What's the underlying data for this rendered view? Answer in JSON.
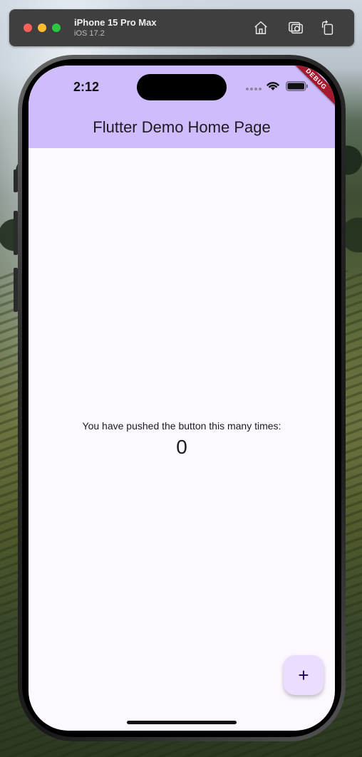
{
  "simulator": {
    "device_name": "iPhone 15 Pro Max",
    "os_version": "iOS 17.2",
    "toolbar_icons": [
      "home-icon",
      "screenshot-icon",
      "rotate-icon"
    ]
  },
  "status_bar": {
    "time": "2:12",
    "icons": [
      "wifi-icon",
      "battery-icon"
    ]
  },
  "app": {
    "title": "Flutter Demo Home Page",
    "debug_banner": "DEBUG",
    "counter_label": "You have pushed the button this many times:",
    "counter_value": "0",
    "fab_icon": "+",
    "colors": {
      "appbar": "#cfbcfd",
      "background": "#fdf7ff",
      "fab": "#eaddff",
      "fab_icon": "#21005d",
      "debug": "#a5192e"
    }
  }
}
